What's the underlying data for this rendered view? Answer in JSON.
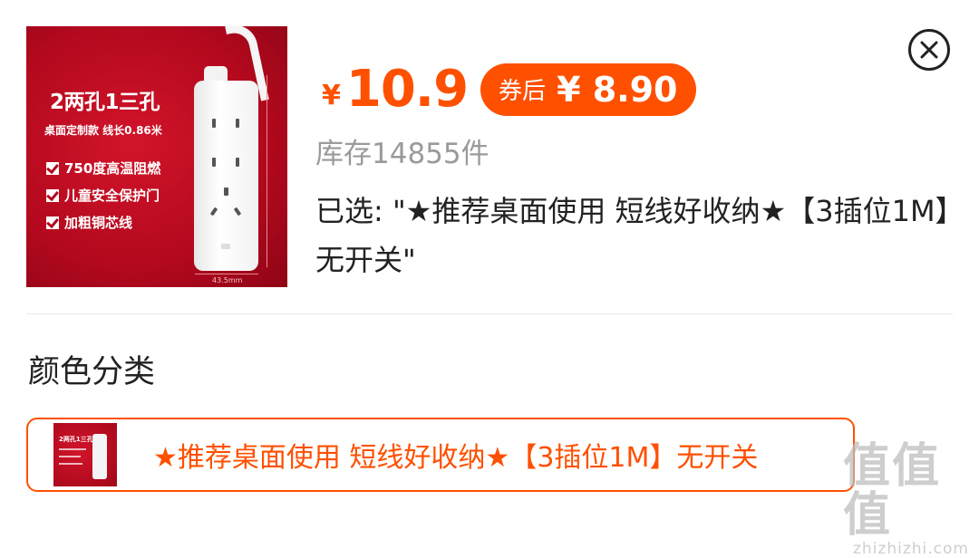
{
  "product": {
    "image_text": {
      "title": "2两孔1三孔",
      "subtitle": "桌面定制款 线长0.86米",
      "features": [
        "750度高温阻燃",
        "儿童安全保护门",
        "加粗铜芯线"
      ],
      "dimension_width": "43.5mm"
    },
    "price": {
      "currency": "¥",
      "value": "10.9",
      "coupon_label": "券后",
      "coupon_price": "¥ 8.90"
    },
    "stock_text": "库存14855件",
    "selected_text": "已选: \"★推荐桌面使用 短线好收纳★【3插位1M】无开关\""
  },
  "variants": {
    "section_title": "颜色分类",
    "options": [
      {
        "label": "★推荐桌面使用 短线好收纳★【3插位1M】无开关",
        "selected": true,
        "thumb_title": "2两孔1三孔"
      }
    ]
  },
  "watermark": {
    "glyphs": "值值值",
    "domain": "zhizhizhi.com"
  },
  "colors": {
    "accent": "#ff5000",
    "image_bg": "#b3091e"
  },
  "icons": {
    "close": "close-circle-icon",
    "check": "check-icon"
  }
}
